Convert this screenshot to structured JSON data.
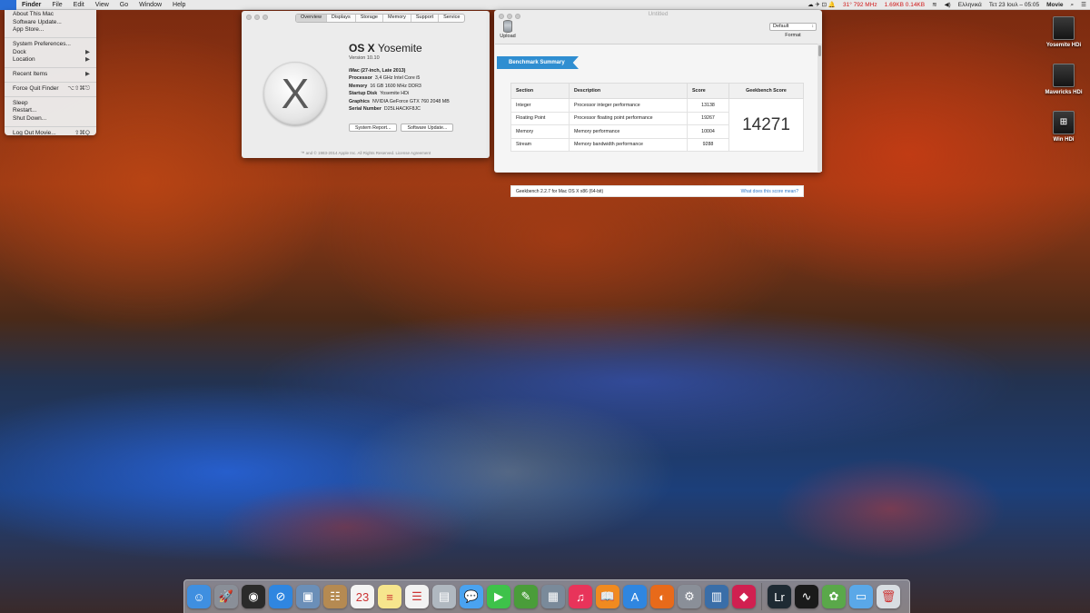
{
  "menubar": {
    "app_name": "Finder",
    "items": [
      "File",
      "Edit",
      "View",
      "Go",
      "Window",
      "Help"
    ],
    "status": {
      "temp_speed": "31° 792 MHz",
      "net": "1.69KB 0.14KB",
      "lang": "Ελληνικά",
      "clock": "Τετ 23 Ιουλ – 05:05",
      "app": "Movie"
    }
  },
  "apple_menu": {
    "items": [
      {
        "label": "About This Mac",
        "shortcut": ""
      },
      {
        "label": "Software Update...",
        "shortcut": ""
      },
      {
        "label": "App Store...",
        "shortcut": ""
      },
      {
        "sep": true
      },
      {
        "label": "System Preferences...",
        "shortcut": ""
      },
      {
        "label": "Dock",
        "shortcut": "▶"
      },
      {
        "label": "Location",
        "shortcut": "▶"
      },
      {
        "sep": true
      },
      {
        "label": "Recent Items",
        "shortcut": "▶"
      },
      {
        "sep": true
      },
      {
        "label": "Force Quit Finder",
        "shortcut": "⌥⇧⌘⎋"
      },
      {
        "sep": true
      },
      {
        "label": "Sleep",
        "shortcut": ""
      },
      {
        "label": "Restart...",
        "shortcut": ""
      },
      {
        "label": "Shut Down...",
        "shortcut": ""
      },
      {
        "sep": true
      },
      {
        "label": "Log Out Movie...",
        "shortcut": "⇧⌘Q"
      }
    ]
  },
  "about": {
    "tabs": [
      "Overview",
      "Displays",
      "Storage",
      "Memory",
      "Support",
      "Service"
    ],
    "os_name_bold": "OS X",
    "os_name": "Yosemite",
    "version": "Version 10.10",
    "logo": "X",
    "specs": [
      {
        "k": "iMac (27-inch, Late 2013)",
        "v": ""
      },
      {
        "k": "Processor",
        "v": "3,4 GHz Intel Core i5"
      },
      {
        "k": "Memory",
        "v": "16 GB 1600 MHz DDR3"
      },
      {
        "k": "Startup Disk",
        "v": "Yosemite HDi"
      },
      {
        "k": "Graphics",
        "v": "NVIDIA GeForce GTX 760 2048 MB"
      },
      {
        "k": "Serial Number",
        "v": "D25LHACKF8JC"
      }
    ],
    "btn_report": "System Report...",
    "btn_update": "Software Update...",
    "footer": "™ and © 1983-2014 Apple Inc. All Rights Reserved. License Agreement"
  },
  "geekbench": {
    "title": "Untitled",
    "upload": "Upload",
    "format_value": "Default",
    "format_label": "Format",
    "ribbon": "Benchmark Summary",
    "headers": [
      "Section",
      "Description",
      "Score",
      "Geekbench Score"
    ],
    "rows": [
      {
        "section": "Integer",
        "desc": "Processor integer performance",
        "score": "13138"
      },
      {
        "section": "Floating Point",
        "desc": "Processor floating point performance",
        "score": "19267"
      },
      {
        "section": "Memory",
        "desc": "Memory performance",
        "score": "10004"
      },
      {
        "section": "Stream",
        "desc": "Memory bandwidth performance",
        "score": "9288"
      }
    ],
    "total": "14271",
    "version": "Geekbench 2.2.7 for Mac OS X x86 (64-bit)",
    "link": "What does this score mean?"
  },
  "drives": [
    "Yosemite HDi",
    "Mavericks HDi",
    "Win HDi"
  ],
  "dock": {
    "icons": [
      {
        "name": "finder-icon",
        "color": "#3f8fe0",
        "glyph": "☺"
      },
      {
        "name": "launchpad-icon",
        "color": "#8a8f98",
        "glyph": "🚀"
      },
      {
        "name": "dashboard-icon",
        "color": "#2a2a2a",
        "glyph": "◉"
      },
      {
        "name": "safari-icon",
        "color": "#2f86e0",
        "glyph": "⊘"
      },
      {
        "name": "preview-icon",
        "color": "#6b8fb8",
        "glyph": "▣"
      },
      {
        "name": "contacts-icon",
        "color": "#b58a52",
        "glyph": "☷"
      },
      {
        "name": "calendar-icon",
        "color": "#f4f4f4",
        "glyph": "23"
      },
      {
        "name": "notes-icon",
        "color": "#f6e58d",
        "glyph": "≡"
      },
      {
        "name": "reminders-icon",
        "color": "#f2f2f2",
        "glyph": "☰"
      },
      {
        "name": "photo-booth-icon",
        "color": "#b0b8c0",
        "glyph": "▤"
      },
      {
        "name": "messages-icon",
        "color": "#4aa3f0",
        "glyph": "💬"
      },
      {
        "name": "facetime-icon",
        "color": "#3ec24a",
        "glyph": "▶"
      },
      {
        "name": "evernote-icon",
        "color": "#4a9d3a",
        "glyph": "✎"
      },
      {
        "name": "image-capture-icon",
        "color": "#7a8a9a",
        "glyph": "▦"
      },
      {
        "name": "itunes-icon",
        "color": "#e8345a",
        "glyph": "♫"
      },
      {
        "name": "ibooks-icon",
        "color": "#f08a20",
        "glyph": "📖"
      },
      {
        "name": "app-store-icon",
        "color": "#2f86e0",
        "glyph": "A"
      },
      {
        "name": "firefox-icon",
        "color": "#e86a1a",
        "glyph": "◐"
      },
      {
        "name": "system-preferences-icon",
        "color": "#8a8f98",
        "glyph": "⚙"
      },
      {
        "name": "geekbench-icon",
        "color": "#3a6ea8",
        "glyph": "▥"
      },
      {
        "name": "vpn-icon",
        "color": "#d02050",
        "glyph": "◆"
      },
      {
        "sep": true
      },
      {
        "name": "lightroom-icon",
        "color": "#1e2a33",
        "glyph": "Lr"
      },
      {
        "name": "activity-monitor-icon",
        "color": "#1a1a1a",
        "glyph": "∿"
      },
      {
        "name": "graph-icon",
        "color": "#5aa84a",
        "glyph": "✿"
      },
      {
        "name": "downloads-folder-icon",
        "color": "#5aa8e8",
        "glyph": "▭"
      },
      {
        "name": "trash-icon",
        "color": "#d8dde2",
        "glyph": "🗑"
      }
    ]
  }
}
